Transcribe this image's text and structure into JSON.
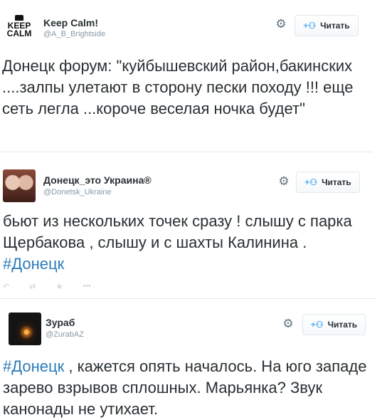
{
  "tweets": [
    {
      "name": "Keep Calm!",
      "handle": "@A_B_Brightside",
      "follow_label": "Читать",
      "text": "Донецк форум: \"куйбышевский район,бакинских ....залпы улетают в сторону пески походу !!! еще сеть легла ...короче веселая ночка будет\""
    },
    {
      "name": "Донецк_это Украина®",
      "handle": "@Donetsk_Ukraine",
      "follow_label": "Читать",
      "text": "бьют из нескольких точек сразу ! слышу с парка Щербакова , слышу и с шахты Калинина . ",
      "hashtag": "#Донецк"
    },
    {
      "name": "Зураб",
      "handle": "@ZurabAZ",
      "follow_label": "Читать",
      "hashtag": "#Донецк",
      "text": " , кажется опять началось. На юго западе зарево взрывов сплошных. Марьянка? Звук канонады не утихает."
    }
  ],
  "icons": {
    "gear": "gear-icon",
    "follow_plus": "add-user-icon",
    "reply": "reply-icon",
    "retweet": "retweet-icon",
    "favorite": "star-icon",
    "more": "more-icon"
  },
  "colors": {
    "hashtag": "#2b7bb9",
    "follow_icon": "#55acee",
    "text": "#292f33",
    "handle": "#8899a6"
  },
  "avatar_text": {
    "keep_calm": [
      "KEEP",
      "CALM"
    ]
  }
}
